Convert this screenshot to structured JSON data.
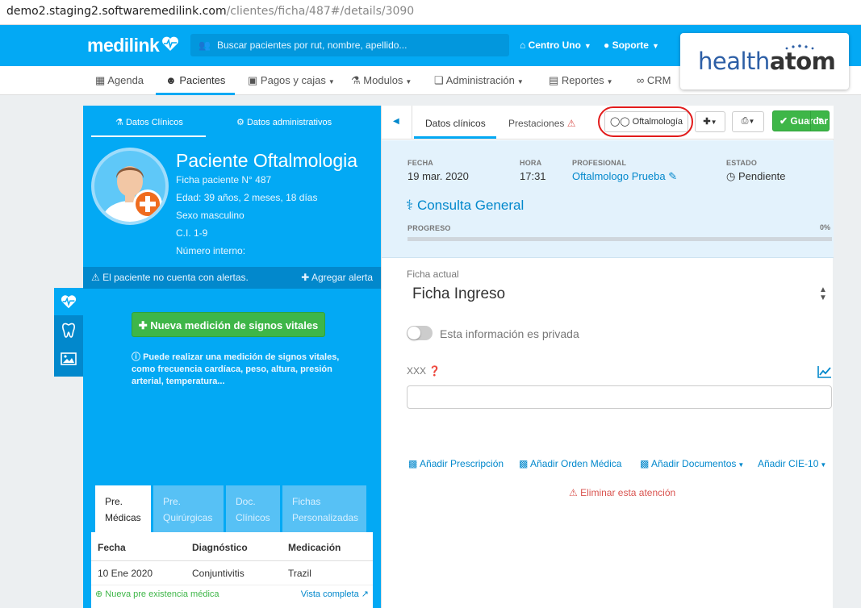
{
  "browser": {
    "url_host": "demo2.staging2.softwaremedilink.com",
    "url_path": "/clientes/ficha/487#/details/3090"
  },
  "topbar": {
    "logo": "medilink",
    "search_placeholder": "Buscar pacientes por rut, nombre, apellido...",
    "center": "Centro Uno",
    "support": "Soporte",
    "brand_logo": "healthatom"
  },
  "nav": {
    "items": [
      "Agenda",
      "Pacientes",
      "Pagos y cajas",
      "Modulos",
      "Administración",
      "Reportes",
      "CRM"
    ]
  },
  "patient": {
    "tab_clinical": "Datos Clínicos",
    "tab_admin": "Datos administrativos",
    "name": "Paciente Oftalmologia",
    "record": "Ficha paciente N° 487",
    "age": "Edad: 39 años, 2 meses, 18 días",
    "sex": "Sexo masculino",
    "ci": "C.I. 1-9",
    "internal": "Número interno:",
    "alert_text": "El paciente no cuenta con alertas.",
    "add_alert": "Agregar alerta",
    "vital_button": "Nueva medición de signos vitales",
    "vital_info": "Puede realizar una medición de signos vitales, como frecuencia cardíaca, peso, altura, presión arterial, temperatura..."
  },
  "history_tabs": [
    {
      "line1": "Pre.",
      "line2": "Médicas"
    },
    {
      "line1": "Pre.",
      "line2": "Quirúrgicas"
    },
    {
      "line1": "Doc.",
      "line2": "Clínicos"
    },
    {
      "line1": "Fichas",
      "line2": "Personalizadas"
    }
  ],
  "history_table": {
    "headers": [
      "Fecha",
      "Diagnóstico",
      "Medicación"
    ],
    "rows": [
      [
        "10 Ene 2020",
        "Conjuntivitis",
        "Trazil"
      ]
    ],
    "new_link": "Nueva pre existencia médica",
    "full_link": "Vista completa"
  },
  "right": {
    "tab_clinical": "Datos clínicos",
    "tab_services": "Prestaciones",
    "specialty_button": "Oftalmología",
    "save_button": "Guardar",
    "labels": {
      "date": "FECHA",
      "time": "HORA",
      "professional": "PROFESIONAL",
      "status": "ESTADO",
      "progress": "PROGRESO"
    },
    "date": "19 mar. 2020",
    "time": "17:31",
    "professional": "Oftalmologo Prueba",
    "status": "Pendiente",
    "consulta": "Consulta General",
    "progress": 0,
    "progress_label": "0%",
    "ficha_label": "Ficha actual",
    "ficha_value": "Ficha Ingreso",
    "private_label": "Esta información es privada",
    "field_label": "XXX",
    "actions": [
      "Añadir Prescripción",
      "Añadir Orden Médica",
      "Añadir Documentos",
      "Añadir CIE-10"
    ],
    "delete": "Eliminar esta atención"
  },
  "colors": {
    "primary": "#03a9f4",
    "dark_primary": "#0288cc",
    "green": "#3eb648",
    "red": "#d9534f",
    "highlight": "#e21b1b"
  }
}
